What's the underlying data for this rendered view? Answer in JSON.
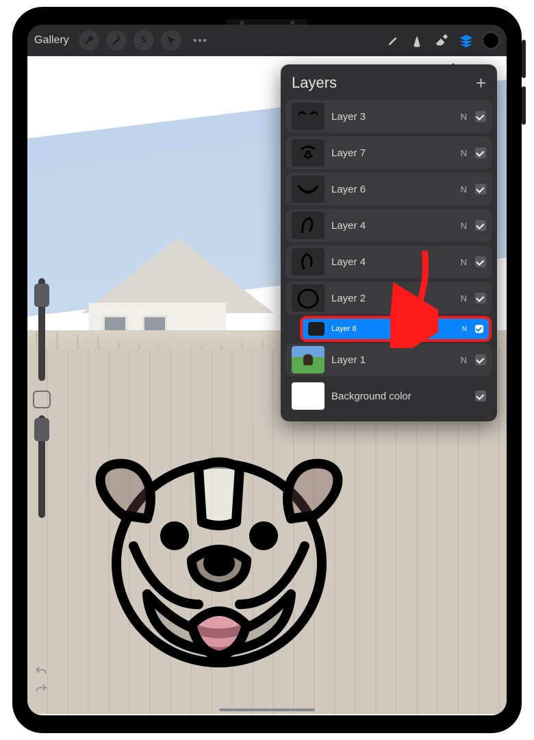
{
  "toolbar": {
    "gallery_label": "Gallery"
  },
  "layers_panel": {
    "title": "Layers",
    "layers": [
      {
        "name": "Layer 3",
        "blend": "N",
        "visible": true,
        "thumb": "eyes"
      },
      {
        "name": "Layer 7",
        "blend": "N",
        "visible": true,
        "thumb": "nose"
      },
      {
        "name": "Layer 6",
        "blend": "N",
        "visible": true,
        "thumb": "mouth"
      },
      {
        "name": "Layer 4",
        "blend": "N",
        "visible": true,
        "thumb": "ear1"
      },
      {
        "name": "Layer 4",
        "blend": "N",
        "visible": true,
        "thumb": "ear2"
      },
      {
        "name": "Layer 2",
        "blend": "N",
        "visible": true,
        "thumb": "head"
      },
      {
        "name": "Layer 8",
        "blend": "N",
        "visible": true,
        "thumb": "dark",
        "dragging": true
      },
      {
        "name": "Layer 1",
        "blend": "N",
        "visible": true,
        "thumb": "photo"
      },
      {
        "name": "Background color",
        "blend": "",
        "visible": true,
        "thumb": "white",
        "plain": true
      }
    ]
  },
  "colors": {
    "accent": "#0a84ff",
    "highlight": "#ff1a1a"
  }
}
